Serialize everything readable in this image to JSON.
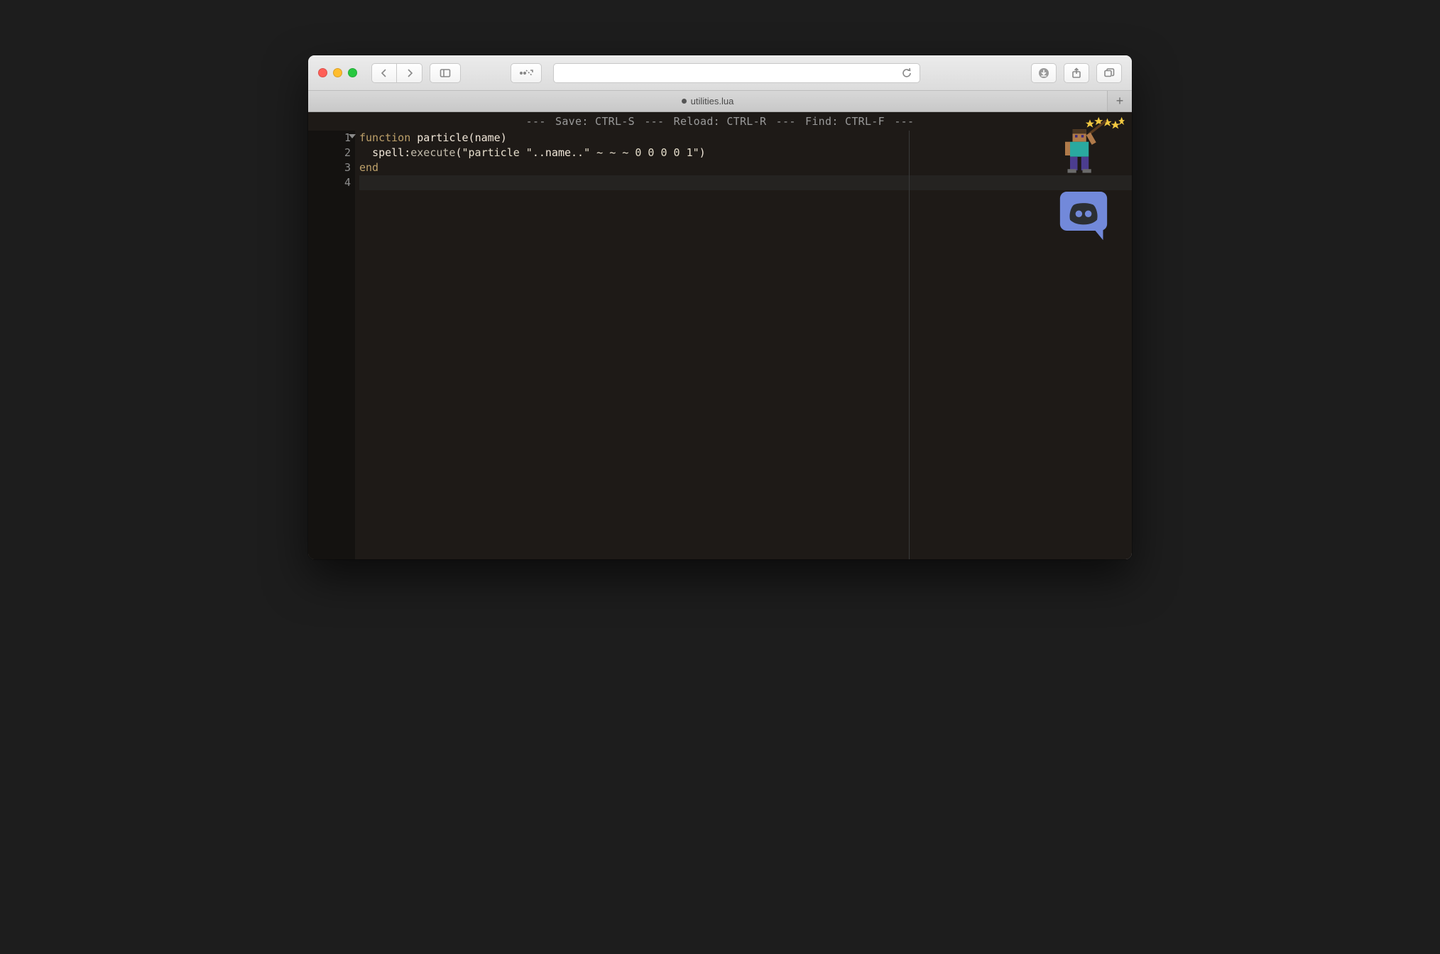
{
  "tab": {
    "title": "utilities.lua",
    "dirty": true
  },
  "hint": {
    "save": "Save: CTRL-S",
    "reload": "Reload: CTRL-R",
    "find": "Find: CTRL-F",
    "sep": "---"
  },
  "editor": {
    "lines": [
      {
        "n": "1",
        "foldable": true,
        "tokens": [
          {
            "cls": "kw",
            "t": "function"
          },
          {
            "cls": "op",
            "t": " "
          },
          {
            "cls": "fn",
            "t": "particle"
          },
          {
            "cls": "par",
            "t": "("
          },
          {
            "cls": "fn",
            "t": "name"
          },
          {
            "cls": "par",
            "t": ")"
          }
        ]
      },
      {
        "n": "2",
        "tokens": [
          {
            "cls": "op",
            "t": "  "
          },
          {
            "cls": "fn",
            "t": "spell"
          },
          {
            "cls": "op",
            "t": ":"
          },
          {
            "cls": "mth",
            "t": "execute"
          },
          {
            "cls": "par",
            "t": "("
          },
          {
            "cls": "str",
            "t": "\"particle \""
          },
          {
            "cls": "op",
            "t": ".."
          },
          {
            "cls": "fn",
            "t": "name"
          },
          {
            "cls": "op",
            "t": ".."
          },
          {
            "cls": "str",
            "t": "\" ~ ~ ~ 0 0 0 0 1\""
          },
          {
            "cls": "par",
            "t": ")"
          }
        ]
      },
      {
        "n": "3",
        "tokens": [
          {
            "cls": "kw",
            "t": "end"
          }
        ]
      },
      {
        "n": "4",
        "active": true,
        "tokens": []
      }
    ]
  },
  "icons": {
    "back": "‹",
    "forward": "›",
    "plus": "+"
  }
}
